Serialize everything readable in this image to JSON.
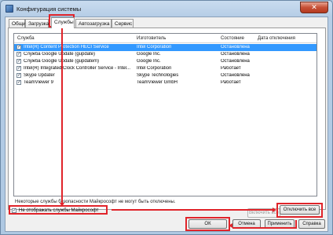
{
  "window": {
    "title": "Конфигурация системы",
    "close_glyph": "✕"
  },
  "tabs": [
    {
      "label": "Общие"
    },
    {
      "label": "Загрузка"
    },
    {
      "label": "Службы"
    },
    {
      "label": "Автозагрузка"
    },
    {
      "label": "Сервис"
    }
  ],
  "services": {
    "columns": [
      "Служба",
      "Изготовитель",
      "Состояние",
      "Дата отключения"
    ],
    "rows": [
      {
        "checked": true,
        "name": "Intel(R) Content Protection HECI Service",
        "vendor": "Intel Corporation",
        "state": "Остановлена",
        "date": "",
        "selected": true
      },
      {
        "checked": true,
        "name": "Служба Google Update (gupdate)",
        "vendor": "Google Inc.",
        "state": "Остановлена",
        "date": ""
      },
      {
        "checked": true,
        "name": "Служба Google Update (gupdatem)",
        "vendor": "Google Inc.",
        "state": "Остановлена",
        "date": ""
      },
      {
        "checked": true,
        "name": "Intel(R) Integrated Clock Controller Service - Intel...",
        "vendor": "Intel Corporation",
        "state": "Работает",
        "date": ""
      },
      {
        "checked": true,
        "name": "Skype Updater",
        "vendor": "Skype Technologies",
        "state": "Остановлена",
        "date": ""
      },
      {
        "checked": true,
        "name": "TeamViewer 9",
        "vendor": "TeamViewer GmbH",
        "state": "Работает",
        "date": ""
      }
    ]
  },
  "footer": {
    "note": "Некоторые службы безопасности Майкрософт не могут быть отключены.",
    "hide_ms_label": "Не отображать службы Майкрософт",
    "hide_ms_checked": true,
    "enable_all": "Включить все",
    "disable_all": "Отключить все"
  },
  "dialog_buttons": {
    "ok": "ОК",
    "cancel": "Отмена",
    "apply": "Применить",
    "help": "Справка"
  },
  "colors": {
    "accent_red": "#e0242a",
    "selection": "#3399ff"
  }
}
